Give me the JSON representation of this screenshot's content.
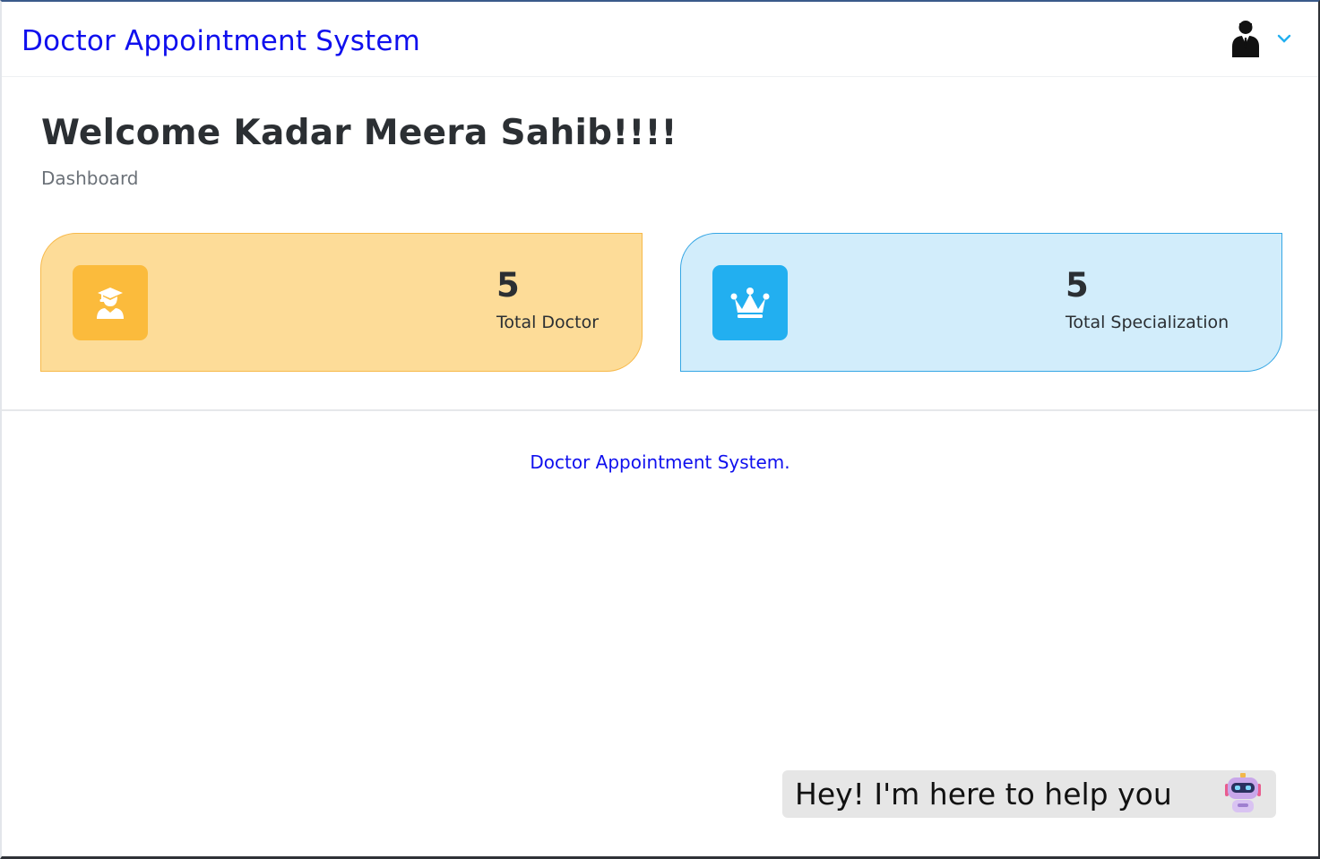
{
  "header": {
    "app_title": "Doctor Appointment System",
    "user_avatar_icon": "user-avatar-icon",
    "user_menu_icon": "chevron-down-icon",
    "accent_color": "#1010ee"
  },
  "main": {
    "welcome": "Welcome Kadar Meera Sahib!!!!",
    "breadcrumb": "Dashboard",
    "cards": [
      {
        "value": "5",
        "label": "Total Doctor",
        "icon": "graduate-icon",
        "bg_color": "#fddc98",
        "icon_color": "#fbbb3c"
      },
      {
        "value": "5",
        "label": "Total Specialization",
        "icon": "crown-icon",
        "bg_color": "#d2edfb",
        "icon_color": "#22aff0"
      }
    ]
  },
  "footer": {
    "text": "Doctor Appointment System."
  },
  "chat_widget": {
    "message": "Hey! I'm here to help you",
    "icon": "robot-icon"
  }
}
